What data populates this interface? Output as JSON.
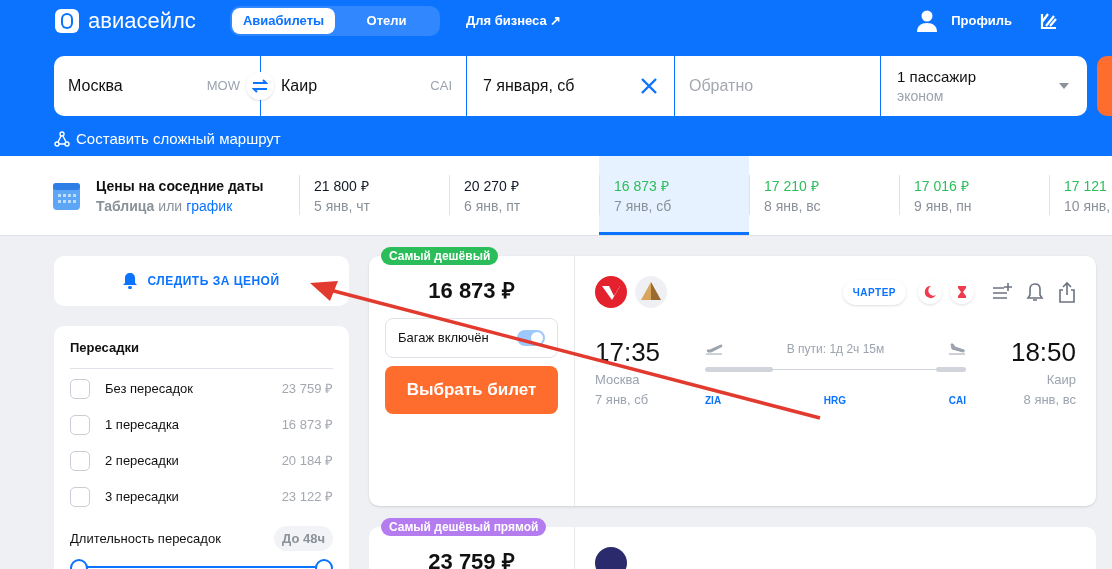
{
  "header": {
    "logo": "авиасейлс",
    "tabs": [
      {
        "label": "Авиабилеты",
        "selected": true
      },
      {
        "label": "Отели",
        "selected": false
      }
    ],
    "business_link": "Для бизнеса ↗",
    "profile": "Профиль"
  },
  "search": {
    "origin": {
      "city": "Москва",
      "code": "MOW"
    },
    "destination": {
      "city": "Каир",
      "code": "CAI"
    },
    "date": "7 января, сб",
    "return_placeholder": "Обратно",
    "passengers": "1 пассажир",
    "cabin": "эконом",
    "complex_route": "Составить сложный маршрут"
  },
  "nearby_dates": {
    "title": "Цены на соседние даты",
    "table_link": "Таблица",
    "or": "или",
    "chart_link": "график",
    "dates": [
      {
        "price": "21 800 ₽",
        "date": "5 янв, чт",
        "selected": false,
        "color": "#111827"
      },
      {
        "price": "20 270 ₽",
        "date": "6 янв, пт",
        "selected": false,
        "color": "#111827"
      },
      {
        "price": "16 873 ₽",
        "date": "7 янв, сб",
        "selected": true,
        "color": "#2bbd5a"
      },
      {
        "price": "17 210 ₽",
        "date": "8 янв, вс",
        "selected": false,
        "color": "#2bbd5a"
      },
      {
        "price": "17 016 ₽",
        "date": "9 янв, пн",
        "selected": false,
        "color": "#2bbd5a"
      },
      {
        "price": "17 121",
        "date": "10 янв,",
        "selected": false,
        "color": "#2bbd5a"
      }
    ]
  },
  "follow_price": "СЛЕДИТЬ ЗА ЦЕНОЙ",
  "filters": {
    "title": "Пересадки",
    "stops": [
      {
        "label": "Без пересадок",
        "price": "23 759 ₽",
        "checked": false
      },
      {
        "label": "1 пересадка",
        "price": "16 873 ₽",
        "checked": false
      },
      {
        "label": "2 пересадки",
        "price": "20 184 ₽",
        "checked": false
      },
      {
        "label": "3 пересадки",
        "price": "23 122 ₽",
        "checked": false
      }
    ],
    "duration_label": "Длительность пересадок",
    "duration_value": "До 48ч",
    "duration_range": [
      {
        "level": 0
      },
      {
        "level": 1
      }
    ]
  },
  "tickets": [
    {
      "badge": "Самый дешёвый",
      "color": "#2bbd5a",
      "price": "16 873 ₽",
      "baggage": {
        "label": "Багаж включён",
        "on": true
      },
      "button": "Выбрать билет",
      "tag": "ЧАРТЕР",
      "depart": {
        "time": "17:35",
        "city": "Москва",
        "date": "7 янв, сб"
      },
      "arrive": {
        "time": "18:50",
        "city": "Каир",
        "date": "8 янв, вс"
      },
      "duration": "В пути: 1д 2ч 15м",
      "airports": [
        "ZIA",
        "HRG",
        "CAI"
      ]
    },
    {
      "badge": "Самый дешёвый прямой",
      "color": "#b57cf0",
      "price": "23 759 ₽"
    }
  ]
}
